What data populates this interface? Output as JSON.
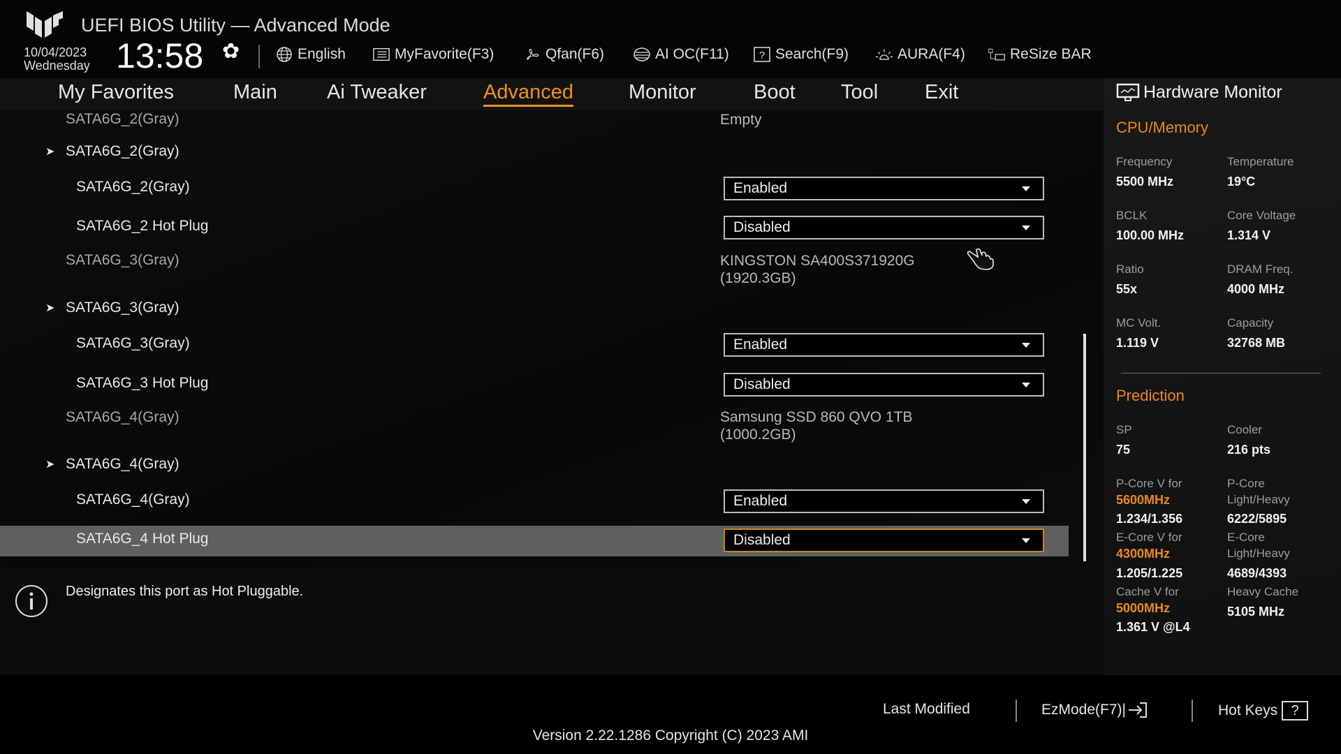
{
  "header": {
    "title": "UEFI BIOS Utility — Advanced Mode",
    "date": "10/04/2023",
    "weekday": "Wednesday",
    "time": "13:58",
    "tools": [
      {
        "label": "English",
        "icon": "globe-icon"
      },
      {
        "label": "MyFavorite(F3)",
        "icon": "favorite-list-icon"
      },
      {
        "label": "Qfan(F6)",
        "icon": "fan-icon"
      },
      {
        "label": "AI OC(F11)",
        "icon": "ai-chip-icon"
      },
      {
        "label": "Search(F9)",
        "icon": "search-help-icon"
      },
      {
        "label": "AURA(F4)",
        "icon": "aura-light-icon"
      },
      {
        "label": "ReSize BAR",
        "icon": "resize-bar-icon"
      }
    ]
  },
  "nav": {
    "tabs": [
      "My Favorites",
      "Main",
      "Ai Tweaker",
      "Advanced",
      "Monitor",
      "Boot",
      "Tool",
      "Exit"
    ],
    "active": "Advanced"
  },
  "list": [
    {
      "type": "info",
      "label": "SATA6G_2(Gray)",
      "value": "Empty",
      "value2": ""
    },
    {
      "type": "submenu",
      "label": "SATA6G_2(Gray)"
    },
    {
      "type": "option",
      "label": "SATA6G_2(Gray)",
      "value": "Enabled"
    },
    {
      "type": "option",
      "label": "SATA6G_2 Hot Plug",
      "value": "Disabled"
    },
    {
      "type": "info",
      "label": "SATA6G_3(Gray)",
      "value": "KINGSTON SA400S371920G",
      "value2": "(1920.3GB)"
    },
    {
      "type": "submenu",
      "label": "SATA6G_3(Gray)"
    },
    {
      "type": "option",
      "label": "SATA6G_3(Gray)",
      "value": "Enabled"
    },
    {
      "type": "option",
      "label": "SATA6G_3 Hot Plug",
      "value": "Disabled"
    },
    {
      "type": "info",
      "label": "SATA6G_4(Gray)",
      "value": "Samsung SSD 860 QVO 1TB",
      "value2": "(1000.2GB)"
    },
    {
      "type": "submenu",
      "label": "SATA6G_4(Gray)"
    },
    {
      "type": "option",
      "label": "SATA6G_4(Gray)",
      "value": "Enabled"
    },
    {
      "type": "option",
      "label": "SATA6G_4 Hot Plug",
      "value": "Disabled",
      "selected": true
    }
  ],
  "help": {
    "text": "Designates this port as Hot Pluggable."
  },
  "hw": {
    "title": "Hardware Monitor",
    "cpu_head": "CPU/Memory",
    "cpu": [
      {
        "label": "Frequency",
        "value": "5500 MHz"
      },
      {
        "label": "Temperature",
        "value": "19°C"
      },
      {
        "label": "BCLK",
        "value": "100.00 MHz"
      },
      {
        "label": "Core Voltage",
        "value": "1.314 V"
      },
      {
        "label": "Ratio",
        "value": "55x"
      },
      {
        "label": "DRAM Freq.",
        "value": "4000 MHz"
      },
      {
        "label": "MC Volt.",
        "value": "1.119 V"
      },
      {
        "label": "Capacity",
        "value": "32768 MB"
      }
    ],
    "pred_head": "Prediction",
    "sp": {
      "label": "SP",
      "value": "75"
    },
    "cooler": {
      "label": "Cooler",
      "value": "216 pts"
    },
    "pcore_v": {
      "label": "P-Core V for",
      "freq": "5600MHz",
      "value": "1.234/1.356"
    },
    "pcore_lh": {
      "label": "P-Core",
      "label2": "Light/Heavy",
      "value": "6222/5895"
    },
    "ecore_v": {
      "label": "E-Core V for",
      "freq": "4300MHz",
      "value": "1.205/1.225"
    },
    "ecore_lh": {
      "label": "E-Core",
      "label2": "Light/Heavy",
      "value": "4689/4393"
    },
    "cache_v": {
      "label": "Cache V for",
      "freq": "5000MHz",
      "value": "1.361 V @L4"
    },
    "heavy_cache": {
      "label": "Heavy Cache",
      "value": "5105 MHz"
    }
  },
  "footer": {
    "last_modified": "Last Modified",
    "ezmode": "EzMode(F7)|",
    "hotkeys": "Hot Keys",
    "hotkeys_icon": "?",
    "version": "Version 2.22.1286 Copyright (C) 2023 AMI"
  },
  "colors": {
    "accent": "#f0901c",
    "highlight": "#5f5f5f"
  }
}
